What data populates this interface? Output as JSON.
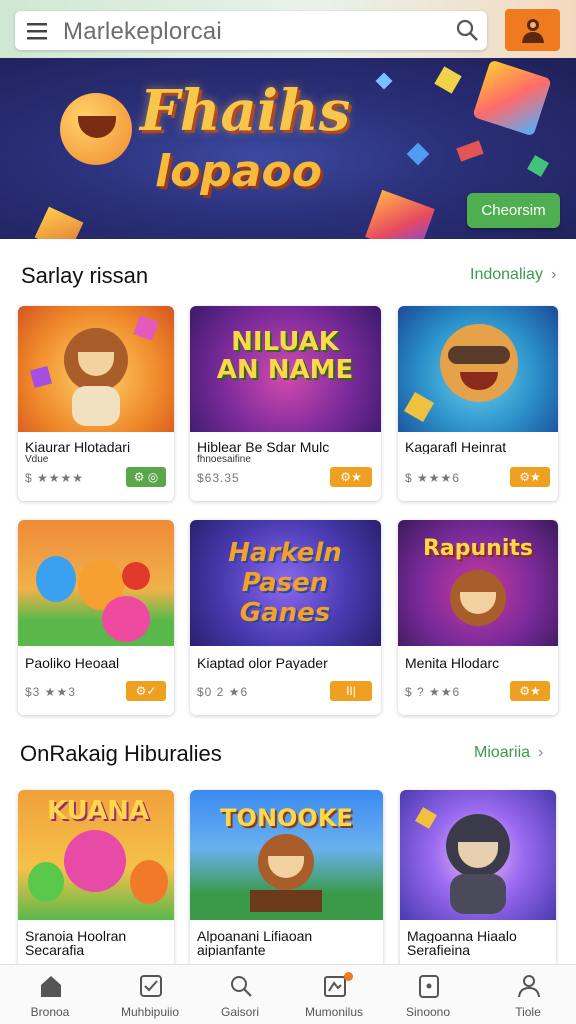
{
  "header": {
    "search_text": "Marlekeplorcai",
    "colors": {
      "profile_button": "#ef7a1f",
      "accent_green": "#4fae4f"
    }
  },
  "banner": {
    "title": "Fhaihs",
    "subtitle": "lopaoo",
    "button_label": "Cheorsim"
  },
  "sections": [
    {
      "title": "Sarlay rissan",
      "link": "Indonaliay",
      "cards": [
        {
          "image_text": "",
          "title": "Kiaurar Hlotadari",
          "subtitle": "Vdue",
          "price": "$ ★★★★",
          "badge": "⚙ ◎"
        },
        {
          "image_text": "NILUAK AN NAME",
          "title": "Hiblear Be Sdar Mulc",
          "subtitle": "fhnoesaifine",
          "price": "$63.35",
          "badge": "⚙★"
        },
        {
          "image_text": "",
          "title": "Kagarafl Heinrat",
          "subtitle": "",
          "price": "$ ★★★6",
          "badge": "⚙★"
        }
      ]
    },
    {
      "title": "OnRakaig Hiburalies",
      "link": "Mioariia",
      "cards": [
        {
          "image_text": "",
          "title": "Paoliko Heoaal",
          "subtitle": "",
          "price": "$3 ★★3",
          "badge": "⚙✓"
        },
        {
          "image_text": "Harkeln Pasen Ganes",
          "title": "Kiaptad olor Payader",
          "subtitle": "",
          "price": "$0 2 ★6",
          "badge": "II|"
        },
        {
          "image_text": "Rapunits",
          "title": "Menita Hlodarc",
          "subtitle": "",
          "price": "$ ? ★★6",
          "badge": "⚙★"
        }
      ]
    },
    {
      "title": "",
      "link": "",
      "cards": [
        {
          "image_text": "KUANA",
          "title": "Sranoia Hoolran",
          "subtitle": "Secarafia",
          "price": "",
          "badge": ""
        },
        {
          "image_text": "TONOOKE",
          "title": "Alpoanani Lifiaoan",
          "subtitle": "aipianfante",
          "price": "",
          "badge": ""
        },
        {
          "image_text": "",
          "title": "Magoanna Hiaalo",
          "subtitle": "Serafieina",
          "price": "",
          "badge": ""
        }
      ]
    }
  ],
  "bottom_nav": [
    {
      "label": "Bronoa",
      "icon": "home-icon"
    },
    {
      "label": "Muhbipuiio",
      "icon": "checklist-icon"
    },
    {
      "label": "Gaisori",
      "icon": "search-icon"
    },
    {
      "label": "Mumonilus",
      "icon": "map-icon"
    },
    {
      "label": "Sinoono",
      "icon": "tablet-icon"
    },
    {
      "label": "Tiole",
      "icon": "profile-icon"
    }
  ]
}
